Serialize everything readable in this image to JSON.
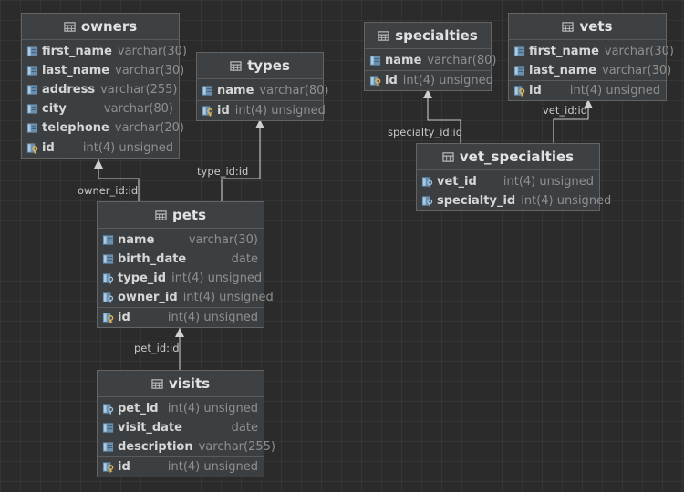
{
  "tables": [
    {
      "id": "owners",
      "name": "owners",
      "columns": [
        {
          "name": "first_name",
          "type": "varchar(30)",
          "icon": "column-icon"
        },
        {
          "name": "last_name",
          "type": "varchar(30)",
          "icon": "column-icon"
        },
        {
          "name": "address",
          "type": "varchar(255)",
          "icon": "column-icon"
        },
        {
          "name": "city",
          "type": "varchar(80)",
          "icon": "column-icon"
        },
        {
          "name": "telephone",
          "type": "varchar(20)",
          "icon": "column-icon"
        }
      ],
      "keys": [
        {
          "name": "id",
          "type": "int(4) unsigned",
          "icon": "primary-key-icon"
        }
      ]
    },
    {
      "id": "types",
      "name": "types",
      "columns": [
        {
          "name": "name",
          "type": "varchar(80)",
          "icon": "column-icon"
        }
      ],
      "keys": [
        {
          "name": "id",
          "type": "int(4) unsigned",
          "icon": "primary-key-icon"
        }
      ]
    },
    {
      "id": "specialties",
      "name": "specialties",
      "columns": [
        {
          "name": "name",
          "type": "varchar(80)",
          "icon": "column-icon"
        }
      ],
      "keys": [
        {
          "name": "id",
          "type": "int(4) unsigned",
          "icon": "primary-key-icon"
        }
      ]
    },
    {
      "id": "vets",
      "name": "vets",
      "columns": [
        {
          "name": "first_name",
          "type": "varchar(30)",
          "icon": "column-icon"
        },
        {
          "name": "last_name",
          "type": "varchar(30)",
          "icon": "column-icon"
        }
      ],
      "keys": [
        {
          "name": "id",
          "type": "int(4) unsigned",
          "icon": "primary-key-icon"
        }
      ]
    },
    {
      "id": "vet_specialties",
      "name": "vet_specialties",
      "columns": [
        {
          "name": "vet_id",
          "type": "int(4) unsigned",
          "icon": "foreign-key-icon"
        },
        {
          "name": "specialty_id",
          "type": "int(4) unsigned",
          "icon": "foreign-key-icon"
        }
      ],
      "keys": []
    },
    {
      "id": "pets",
      "name": "pets",
      "columns": [
        {
          "name": "name",
          "type": "varchar(30)",
          "icon": "column-icon"
        },
        {
          "name": "birth_date",
          "type": "date",
          "icon": "column-icon"
        },
        {
          "name": "type_id",
          "type": "int(4) unsigned",
          "icon": "foreign-key-icon"
        },
        {
          "name": "owner_id",
          "type": "int(4) unsigned",
          "icon": "foreign-key-icon"
        }
      ],
      "keys": [
        {
          "name": "id",
          "type": "int(4) unsigned",
          "icon": "primary-key-icon"
        }
      ]
    },
    {
      "id": "visits",
      "name": "visits",
      "columns": [
        {
          "name": "pet_id",
          "type": "int(4) unsigned",
          "icon": "foreign-key-icon"
        },
        {
          "name": "visit_date",
          "type": "date",
          "icon": "column-icon"
        },
        {
          "name": "description",
          "type": "varchar(255)",
          "icon": "column-icon"
        }
      ],
      "keys": [
        {
          "name": "id",
          "type": "int(4) unsigned",
          "icon": "primary-key-icon"
        }
      ]
    }
  ],
  "relations": [
    {
      "id": "owner",
      "from": "pets",
      "to": "owners",
      "label": "owner_id:id"
    },
    {
      "id": "type",
      "from": "pets",
      "to": "types",
      "label": "type_id:id"
    },
    {
      "id": "pet",
      "from": "visits",
      "to": "pets",
      "label": "pet_id:id"
    },
    {
      "id": "specialty",
      "from": "vet_specialties",
      "to": "specialties",
      "label": "specialty_id:id"
    },
    {
      "id": "vet",
      "from": "vet_specialties",
      "to": "vets",
      "label": "vet_id:id"
    }
  ],
  "colors": {
    "background": "#2b2b2b",
    "table": "#3c3f41",
    "text": "#d6d6d6",
    "type": "#8f8f8f",
    "key": "#e8b64c",
    "column_icon": "#8fb6d8"
  }
}
